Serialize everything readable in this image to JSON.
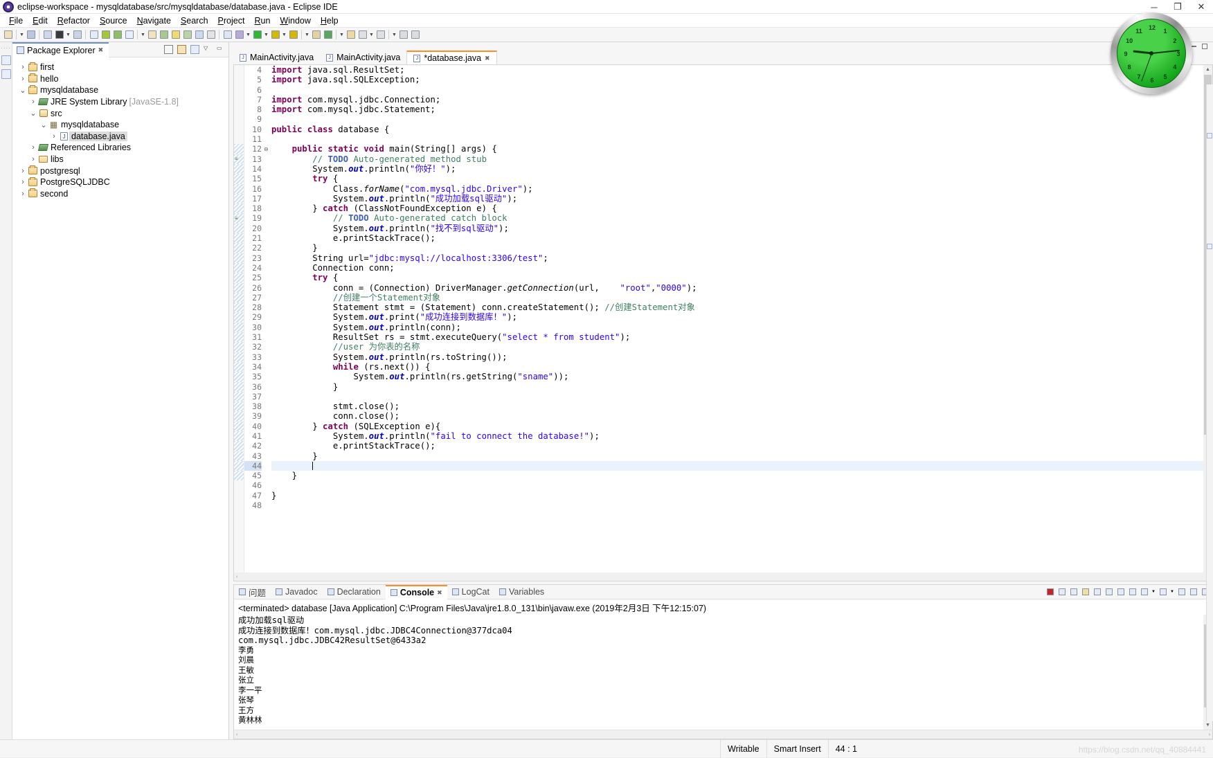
{
  "window": {
    "title": "eclipse-workspace - mysqldatabase/src/mysqldatabase/database.java - Eclipse IDE",
    "app_icon": "eclipse-icon",
    "minimize": "─",
    "maximize": "❐",
    "close": "✕"
  },
  "menubar": {
    "items": [
      "File",
      "Edit",
      "Refactor",
      "Source",
      "Navigate",
      "Search",
      "Project",
      "Run",
      "Window",
      "Help"
    ]
  },
  "toolbar": {
    "icons": [
      "new-wizard-icon",
      "new-wizard-dropdown",
      "save-icon",
      "save-all-icon",
      "debug-perspective-icon",
      "debug-dropdown",
      "open-console-icon",
      "link-editor-icon",
      "android-sdk-manager-icon",
      "android-avd-manager-icon",
      "checkbox-icon",
      "checkbox-dropdown",
      "new-java-class-icon",
      "new-java-package-icon",
      "pencil-icon",
      "annotation-icon",
      "export-icon",
      "assign-icon",
      "paragraph-icon",
      "debug-icon",
      "debug-dropdown-2",
      "run-icon",
      "run-dropdown",
      "coverage-icon",
      "coverage-dropdown",
      "profile-icon",
      "profile-dropdown",
      "external-tools-icon",
      "git-icon",
      "git-dropdown",
      "search-icon",
      "back-icon",
      "back-dropdown",
      "forward-icon",
      "forward-dropdown",
      "previous-edit-icon",
      "next-edit-icon"
    ]
  },
  "package_explorer": {
    "view_title": "Package Explorer",
    "close_label": "✖",
    "view_tools": [
      "collapse-all-icon",
      "link-with-editor-icon",
      "view-filters-icon",
      "view-menu-chevron-icon",
      "minimize-icon"
    ],
    "tree": [
      {
        "label": "first",
        "indent": 0,
        "twisty": "›",
        "icon": "project-icon",
        "selected": false,
        "suffix": ""
      },
      {
        "label": "hello",
        "indent": 0,
        "twisty": "›",
        "icon": "project-icon",
        "selected": false,
        "suffix": ""
      },
      {
        "label": "mysqldatabase",
        "indent": 0,
        "twisty": "⌄",
        "icon": "project-icon",
        "selected": false,
        "suffix": ""
      },
      {
        "label": "JRE System Library",
        "indent": 1,
        "twisty": "›",
        "icon": "library-icon",
        "selected": false,
        "suffix": "[JavaSE-1.8]"
      },
      {
        "label": "src",
        "indent": 1,
        "twisty": "⌄",
        "icon": "source-folder-icon",
        "selected": false,
        "suffix": ""
      },
      {
        "label": "mysqldatabase",
        "indent": 2,
        "twisty": "⌄",
        "icon": "package-icon",
        "selected": false,
        "suffix": ""
      },
      {
        "label": "database.java",
        "indent": 3,
        "twisty": "›",
        "icon": "java-file-icon",
        "selected": true,
        "suffix": ""
      },
      {
        "label": "Referenced Libraries",
        "indent": 1,
        "twisty": "›",
        "icon": "library-icon",
        "selected": false,
        "suffix": ""
      },
      {
        "label": "libs",
        "indent": 1,
        "twisty": "›",
        "icon": "folder-icon",
        "selected": false,
        "suffix": ""
      },
      {
        "label": "postgresql",
        "indent": 0,
        "twisty": "›",
        "icon": "project-icon",
        "selected": false,
        "suffix": ""
      },
      {
        "label": "PostgreSQLJDBC",
        "indent": 0,
        "twisty": "›",
        "icon": "project-icon",
        "selected": false,
        "suffix": ""
      },
      {
        "label": "second",
        "indent": 0,
        "twisty": "›",
        "icon": "project-icon",
        "selected": false,
        "suffix": ""
      }
    ]
  },
  "editor": {
    "tabs": [
      {
        "label": "MainActivity.java",
        "active": false,
        "close": ""
      },
      {
        "label": "MainActivity.java",
        "active": false,
        "close": ""
      },
      {
        "label": "*database.java",
        "active": true,
        "close": "✖"
      }
    ],
    "first_line": 4,
    "lines": [
      {
        "n": 4,
        "blk": false,
        "cur": false,
        "ann": "",
        "fold": "",
        "html": "<span class='k'>import</span> java.sql.ResultSet;"
      },
      {
        "n": 5,
        "blk": false,
        "cur": false,
        "ann": "",
        "fold": "",
        "html": "<span class='k'>import</span> java.sql.SQLException;"
      },
      {
        "n": 6,
        "blk": false,
        "cur": false,
        "ann": "",
        "fold": "",
        "html": ""
      },
      {
        "n": 7,
        "blk": false,
        "cur": false,
        "ann": "",
        "fold": "",
        "html": "<span class='k'>import</span> com.mysql.jdbc.Connection;"
      },
      {
        "n": 8,
        "blk": false,
        "cur": false,
        "ann": "",
        "fold": "",
        "html": "<span class='k'>import</span> com.mysql.jdbc.Statement;"
      },
      {
        "n": 9,
        "blk": false,
        "cur": false,
        "ann": "",
        "fold": "",
        "html": ""
      },
      {
        "n": 10,
        "blk": false,
        "cur": false,
        "ann": "",
        "fold": "",
        "html": "<span class='k'>public</span> <span class='k'>class</span> database {"
      },
      {
        "n": 11,
        "blk": false,
        "cur": false,
        "ann": "",
        "fold": "",
        "html": ""
      },
      {
        "n": 12,
        "blk": true,
        "cur": false,
        "ann": "",
        "fold": "⊖",
        "html": "    <span class='k'>public</span> <span class='k'>static</span> <span class='k'>void</span> main(String[] args) {"
      },
      {
        "n": 13,
        "blk": true,
        "cur": false,
        "ann": "todo",
        "fold": "",
        "html": "        <span class='c'>// </span><span class='td'>TODO</span><span class='c'> Auto-generated method stub</span>"
      },
      {
        "n": 14,
        "blk": true,
        "cur": false,
        "ann": "",
        "fold": "",
        "html": "        System.<span class='stx'>out</span>.println(<span class='s'>\"你好！\"</span>);"
      },
      {
        "n": 15,
        "blk": true,
        "cur": false,
        "ann": "",
        "fold": "",
        "html": "        <span class='k'>try</span> {"
      },
      {
        "n": 16,
        "blk": true,
        "cur": false,
        "ann": "",
        "fold": "",
        "html": "            Class.<span class='f'>forName</span>(<span class='s'>\"com.mysql.jdbc.Driver\"</span>);"
      },
      {
        "n": 17,
        "blk": true,
        "cur": false,
        "ann": "",
        "fold": "",
        "html": "            System.<span class='stx'>out</span>.println(<span class='s'>\"成功加载sql驱动\"</span>);"
      },
      {
        "n": 18,
        "blk": true,
        "cur": false,
        "ann": "",
        "fold": "",
        "html": "        } <span class='k'>catch</span> (ClassNotFoundException e) {"
      },
      {
        "n": 19,
        "blk": true,
        "cur": false,
        "ann": "todo",
        "fold": "",
        "html": "            <span class='c'>// </span><span class='td'>TODO</span><span class='c'> Auto-generated catch block</span>"
      },
      {
        "n": 20,
        "blk": true,
        "cur": false,
        "ann": "",
        "fold": "",
        "html": "            System.<span class='stx'>out</span>.println(<span class='s'>\"找不到sql驱动\"</span>);"
      },
      {
        "n": 21,
        "blk": true,
        "cur": false,
        "ann": "",
        "fold": "",
        "html": "            e.printStackTrace();"
      },
      {
        "n": 22,
        "blk": true,
        "cur": false,
        "ann": "",
        "fold": "",
        "html": "        }"
      },
      {
        "n": 23,
        "blk": true,
        "cur": false,
        "ann": "",
        "fold": "",
        "html": "        String url=<span class='s'>\"jdbc:mysql://localhost:3306/test\"</span>;"
      },
      {
        "n": 24,
        "blk": true,
        "cur": false,
        "ann": "",
        "fold": "",
        "html": "        Connection conn;"
      },
      {
        "n": 25,
        "blk": true,
        "cur": false,
        "ann": "",
        "fold": "",
        "html": "        <span class='k'>try</span> {"
      },
      {
        "n": 26,
        "blk": true,
        "cur": false,
        "ann": "",
        "fold": "",
        "html": "            conn = (Connection) DriverManager.<span class='f'>getConnection</span>(url,    <span class='s'>\"root\"</span>,<span class='s'>\"0000\"</span>);"
      },
      {
        "n": 27,
        "blk": true,
        "cur": false,
        "ann": "",
        "fold": "",
        "html": "            <span class='c'>//创建一个Statement对象</span>"
      },
      {
        "n": 28,
        "blk": true,
        "cur": false,
        "ann": "",
        "fold": "",
        "html": "            Statement stmt = (Statement) conn.createStatement(); <span class='c'>//创建Statement对象</span>"
      },
      {
        "n": 29,
        "blk": true,
        "cur": false,
        "ann": "",
        "fold": "",
        "html": "            System.<span class='stx'>out</span>.print(<span class='s'>\"成功连接到数据库！\"</span>);"
      },
      {
        "n": 30,
        "blk": true,
        "cur": false,
        "ann": "",
        "fold": "",
        "html": "            System.<span class='stx'>out</span>.println(conn);"
      },
      {
        "n": 31,
        "blk": true,
        "cur": false,
        "ann": "",
        "fold": "",
        "html": "            ResultSet rs = stmt.executeQuery(<span class='s'>\"select * from student\"</span>);"
      },
      {
        "n": 32,
        "blk": true,
        "cur": false,
        "ann": "",
        "fold": "",
        "html": "            <span class='c'>//user 为你表的名称</span>"
      },
      {
        "n": 33,
        "blk": true,
        "cur": false,
        "ann": "",
        "fold": "",
        "html": "            System.<span class='stx'>out</span>.println(rs.toString());"
      },
      {
        "n": 34,
        "blk": true,
        "cur": false,
        "ann": "",
        "fold": "",
        "html": "            <span class='k'>while</span> (rs.next()) {"
      },
      {
        "n": 35,
        "blk": true,
        "cur": false,
        "ann": "",
        "fold": "",
        "html": "                System.<span class='stx'>out</span>.println(rs.getString(<span class='s'>\"sname\"</span>));"
      },
      {
        "n": 36,
        "blk": true,
        "cur": false,
        "ann": "",
        "fold": "",
        "html": "            }"
      },
      {
        "n": 37,
        "blk": true,
        "cur": false,
        "ann": "",
        "fold": "",
        "html": ""
      },
      {
        "n": 38,
        "blk": true,
        "cur": false,
        "ann": "",
        "fold": "",
        "html": "            stmt.close();"
      },
      {
        "n": 39,
        "blk": true,
        "cur": false,
        "ann": "",
        "fold": "",
        "html": "            conn.close();"
      },
      {
        "n": 40,
        "blk": true,
        "cur": false,
        "ann": "",
        "fold": "",
        "html": "        } <span class='k'>catch</span> (SQLException e){"
      },
      {
        "n": 41,
        "blk": true,
        "cur": false,
        "ann": "",
        "fold": "",
        "html": "            System.<span class='stx'>out</span>.println(<span class='s'>\"fail to connect the database!\"</span>);"
      },
      {
        "n": 42,
        "blk": true,
        "cur": false,
        "ann": "",
        "fold": "",
        "html": "            e.printStackTrace();"
      },
      {
        "n": 43,
        "blk": true,
        "cur": false,
        "ann": "",
        "fold": "",
        "html": "        }"
      },
      {
        "n": 44,
        "blk": true,
        "cur": true,
        "ann": "",
        "fold": "",
        "html": "        <span class='caret'></span>"
      },
      {
        "n": 45,
        "blk": true,
        "cur": false,
        "ann": "",
        "fold": "",
        "html": "    }"
      },
      {
        "n": 46,
        "blk": false,
        "cur": false,
        "ann": "",
        "fold": "",
        "html": ""
      },
      {
        "n": 47,
        "blk": false,
        "cur": false,
        "ann": "",
        "fold": "",
        "html": "}"
      },
      {
        "n": 48,
        "blk": false,
        "cur": false,
        "ann": "",
        "fold": "",
        "html": ""
      }
    ],
    "hscroll_left": "‹",
    "hscroll_right": "›"
  },
  "bottom_panel": {
    "tabs": [
      {
        "label": "问题",
        "icon": "problems-icon",
        "active": false,
        "close": ""
      },
      {
        "label": "Javadoc",
        "icon": "javadoc-icon",
        "active": false,
        "close": ""
      },
      {
        "label": "Declaration",
        "icon": "declaration-icon",
        "active": false,
        "close": ""
      },
      {
        "label": "Console",
        "icon": "console-icon",
        "active": true,
        "close": "✖"
      },
      {
        "label": "LogCat",
        "icon": "logcat-icon",
        "active": false,
        "close": ""
      },
      {
        "label": "Variables",
        "icon": "variables-icon",
        "active": false,
        "close": ""
      }
    ],
    "tools": [
      "terminate-icon",
      "remove-launch-icon",
      "remove-all-terminated-icon",
      "clear-console-icon",
      "scroll-lock-icon",
      "word-wrap-icon",
      "show-console-on-output-icon",
      "pin-console-icon",
      "display-selected-console-icon",
      "display-selected-dropdown",
      "open-console-icon",
      "open-console-dropdown",
      "view-menu-icon",
      "minimize-icon",
      "maximize-icon"
    ],
    "console": {
      "header": "<terminated> database [Java Application] C:\\Program Files\\Java\\jre1.8.0_131\\bin\\javaw.exe (2019年2月3日 下午12:15:07)",
      "lines": [
        "成功加载sql驱动",
        "成功连接到数据库！com.mysql.jdbc.JDBC4Connection@377dca04",
        "com.mysql.jdbc.JDBC42ResultSet@6433a2",
        "李勇",
        "刘晨",
        "王敏",
        "张立",
        "李一平",
        "张琴",
        "王方",
        "黄林林"
      ]
    }
  },
  "statusbar": {
    "writable": "Writable",
    "insert_mode": "Smart Insert",
    "position": "44 : 1",
    "watermark": "https://blog.csdn.net/qq_40884441"
  },
  "clock": {
    "numbers": [
      "12",
      "1",
      "2",
      "3",
      "4",
      "5",
      "6",
      "7",
      "8",
      "9",
      "10",
      "11"
    ],
    "hour_deg": 276,
    "minute_deg": 84,
    "second_deg": 200,
    "face_color": "#1aa81e"
  }
}
